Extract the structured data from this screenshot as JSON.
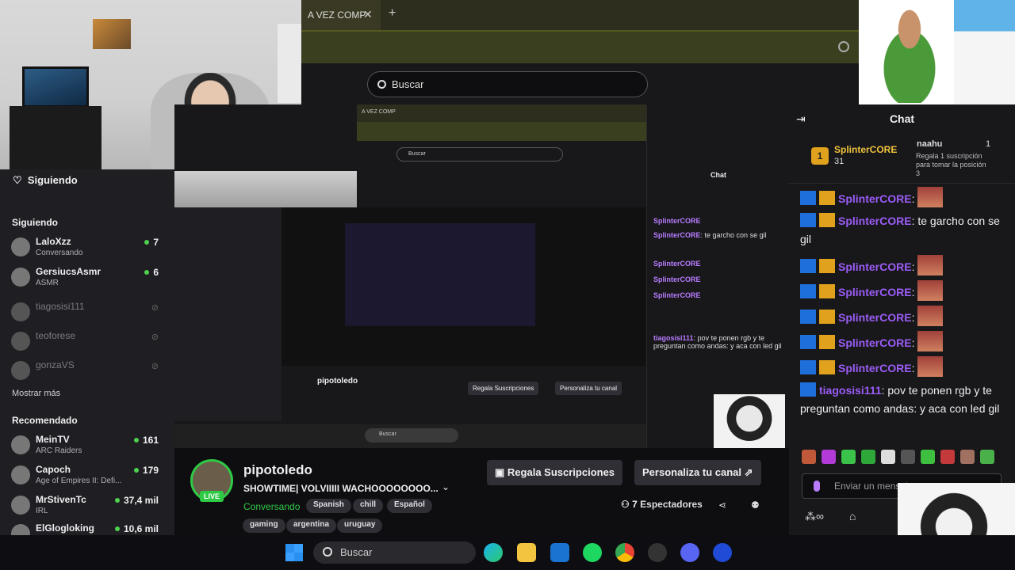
{
  "browser": {
    "tab_title": "A VEZ COMP",
    "search_placeholder": "Buscar"
  },
  "sidebar": {
    "header": "Siguiendo",
    "following_section": "Siguiendo",
    "following": [
      {
        "name": "LaloXzz",
        "sub": "Conversando",
        "count": "7",
        "online": true
      },
      {
        "name": "GersiucsAsmr",
        "sub": "ASMR",
        "count": "6",
        "online": true
      },
      {
        "name": "tiagosisi111",
        "sub": "",
        "count": "",
        "online": false
      },
      {
        "name": "teoforese",
        "sub": "",
        "count": "",
        "online": false
      },
      {
        "name": "gonzaVS",
        "sub": "",
        "count": "",
        "online": false
      }
    ],
    "show_more": "Mostrar más",
    "recommended_section": "Recomendado",
    "recommended": [
      {
        "name": "MeinTV",
        "sub": "ARC Raiders",
        "count": "161"
      },
      {
        "name": "Capoch",
        "sub": "Age of Empires II: Defi...",
        "count": "179"
      },
      {
        "name": "MrStivenTc",
        "sub": "IRL",
        "count": "37,4 mil"
      },
      {
        "name": "ElGlogloking",
        "sub": "",
        "count": "10,6 mil"
      }
    ]
  },
  "stream": {
    "streamer": "pipotoledo",
    "live_label": "LIVE",
    "title": "SHOWTIME| VOLVIIIII WACHOOOOOOOO...",
    "category": "Conversando",
    "tags": [
      "Spanish",
      "chill",
      "Español",
      "gaming",
      "argentina",
      "uruguay"
    ],
    "gift_button": "Regala Suscripciones",
    "customize_button": "Personaliza tu canal",
    "viewers_count": "7",
    "viewers_label": "Espectadores"
  },
  "chat": {
    "title": "Chat",
    "leader1_rank": "1",
    "leader1_name": "SplinterCORE",
    "leader1_sub": "31",
    "leader2_name": "naahu",
    "leader2_count": "1",
    "leader2_text": "Regala 1 suscripción para tomar la posición 3",
    "messages": [
      {
        "user": "SplinterCORE",
        "text": ""
      },
      {
        "user": "SplinterCORE",
        "text": "te garcho con se gil"
      },
      {
        "user": "SplinterCORE",
        "text": ""
      },
      {
        "user": "SplinterCORE",
        "text": ""
      },
      {
        "user": "SplinterCORE",
        "text": ""
      },
      {
        "user": "SplinterCORE",
        "text": ""
      },
      {
        "user": "SplinterCORE",
        "text": ""
      },
      {
        "user": "tiagosisi111",
        "text": "pov te ponen rgb y te preguntan como andas: y aca con led gil"
      }
    ],
    "input_placeholder": "Enviar un mensaje"
  },
  "mini": {
    "chat_title": "Chat",
    "search": "Buscar",
    "streamer": "pipotoledo",
    "gift_button": "Regala Suscripciones",
    "customize_button": "Personaliza tu canal"
  },
  "taskbar": {
    "search_label": "Buscar"
  },
  "colors": {
    "live_green": "#2ec945",
    "chat_nick": "#9b5cf6",
    "leader_gold": "#f0c33c"
  }
}
